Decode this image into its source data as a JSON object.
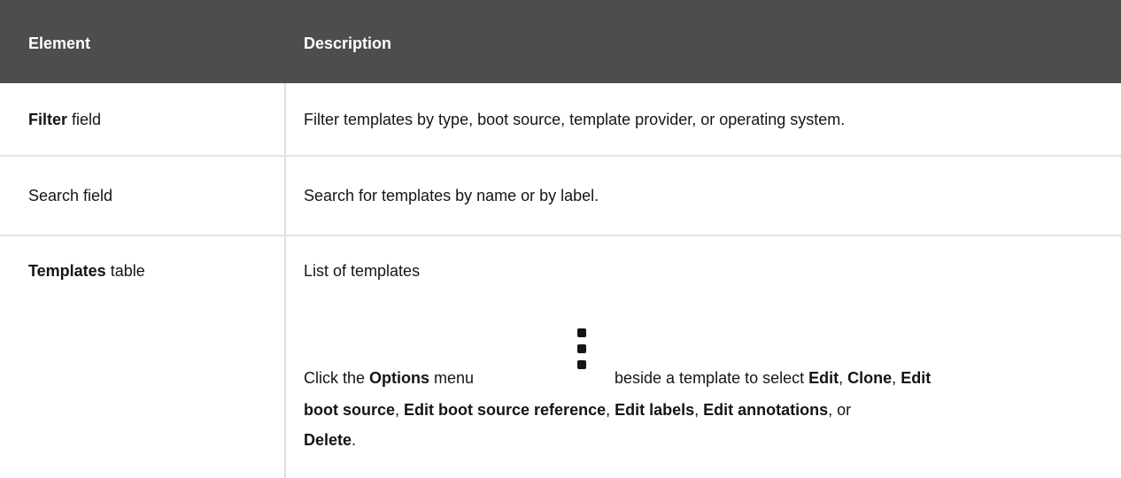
{
  "table": {
    "headers": {
      "element": "Element",
      "description": "Description"
    },
    "rows": [
      {
        "element_bold": "Filter",
        "element_rest": " field",
        "description": "Filter templates by type, boot source, template provider, or operating system."
      },
      {
        "element_plain": "Search field",
        "description": "Search for templates by name or by label."
      },
      {
        "element_bold": "Templates",
        "element_rest": " table",
        "description_line1": "List of templates",
        "description_parts": {
          "p1": "Click the ",
          "options": "Options",
          "p2": " menu",
          "p3": "beside a template to select ",
          "edit": "Edit",
          "sep1": ", ",
          "clone": "Clone",
          "sep2": ", ",
          "edit_boot_1": "Edit",
          "edit_boot_2": "boot source",
          "sep3": ", ",
          "edit_boot_ref": "Edit boot source reference",
          "sep4": ", ",
          "edit_labels": "Edit labels",
          "sep5": ", ",
          "edit_annotations": "Edit annotations",
          "sep6": ", or",
          "delete": "Delete",
          "end": "."
        },
        "icon": "kebab-options-icon"
      }
    ]
  }
}
